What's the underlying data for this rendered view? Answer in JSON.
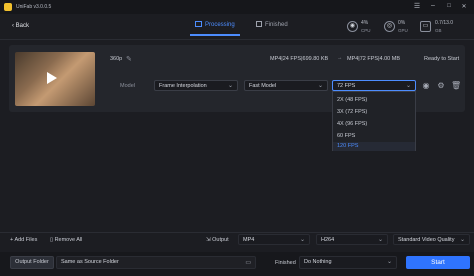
{
  "app": {
    "title": "UniFab v3.0.0.5"
  },
  "window_controls": {
    "menu": "☰",
    "minimize": "–",
    "maximize": "□",
    "close": "✕"
  },
  "header": {
    "back_label": "Back",
    "tabs": [
      {
        "label": "Processing",
        "active": true
      },
      {
        "label": "Finished",
        "active": false
      }
    ],
    "stats": {
      "cpu": {
        "value": "4%",
        "label": "CPU"
      },
      "gpu": {
        "value": "0%",
        "label": "GPU"
      },
      "ram": {
        "value": "0.7/13.0",
        "unit": "GB"
      }
    }
  },
  "task": {
    "resolution": "360p",
    "source_info": "MP4|24 FPS|699.80 KB",
    "output_info": "MP4|72 FPS|4.00 MB",
    "status": "Ready to Start",
    "model_label": "Model",
    "mode_value": "Frame Interpolation",
    "model_value": "Fast Model",
    "fps_value": "72 FPS",
    "fps_options": [
      "2X (48 FPS)",
      "3X (72 FPS)",
      "4X (96 FPS)",
      "60 FPS",
      "120 FPS"
    ],
    "fps_selected_index": 4
  },
  "bottom": {
    "add_files": "Add Files",
    "remove_all": "Remove All",
    "output_label": "Output",
    "format_value": "MP4",
    "codec_value": "H264",
    "quality_value": "Standard Video Quality",
    "output_folder_btn": "Output Folder",
    "folder_value": "Same as Source Folder",
    "finished_label": "Finished",
    "finished_value": "Do Nothing",
    "start_label": "Start"
  },
  "colors": {
    "accent": "#4d8dff",
    "start_button": "#2f74ff",
    "logo": "#f2c12e"
  }
}
